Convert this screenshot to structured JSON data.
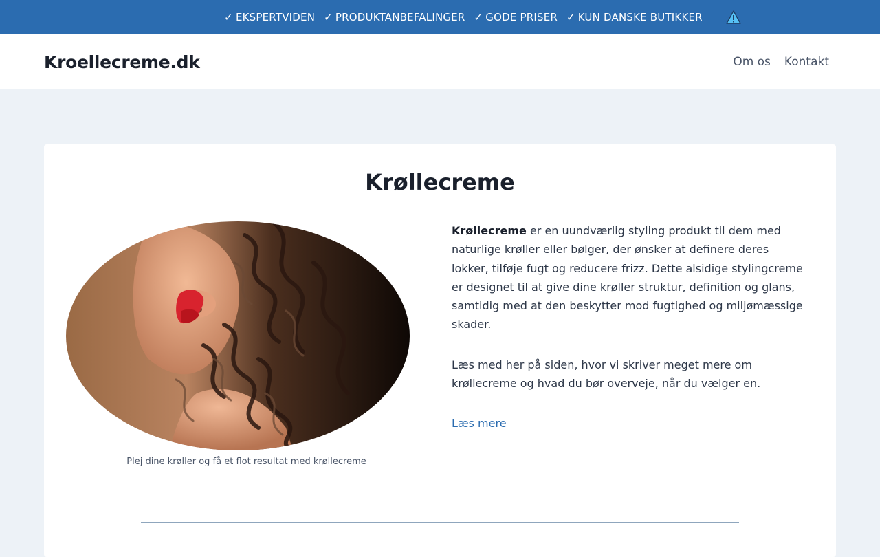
{
  "topbar": {
    "usps": [
      "EKSPERTVIDEN",
      "PRODUKTANBEFALINGER",
      "GODE PRISER",
      "KUN DANSKE BUTIKKER"
    ],
    "check_glyph": "✓",
    "alert_icon": "warning-triangle-icon"
  },
  "header": {
    "logo": "Kroellecreme.dk",
    "nav": [
      "Om os",
      "Kontakt"
    ]
  },
  "main": {
    "title": "Krøllecreme",
    "image_caption": "Plej dine krøller og få et flot resultat med krøllecreme",
    "intro_bold": "Krøllecreme",
    "intro_text": " er en uundværlig styling produkt til dem med naturlige krøller eller bølger, der ønsker at definere deres lokker, tilføje fugt og reducere frizz. Dette alsidige stylingcreme er designet til at give dine krøller struktur, definition og glans, samtidig med at den beskytter mod fugtighed og miljømæssige skader.",
    "paragraph2": "Læs med her på siden, hvor vi skriver meget mere om krøllecreme og hvad du bør overveje, når du vælger en.",
    "read_more": "Læs mere"
  },
  "colors": {
    "topbar_bg": "#2b6cb0",
    "page_bg": "#edf2f7",
    "link": "#2b6cb0"
  }
}
